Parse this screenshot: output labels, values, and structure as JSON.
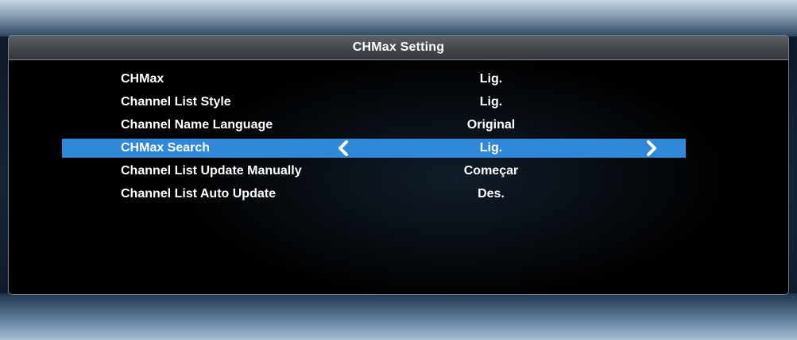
{
  "window": {
    "title": "CHMax Setting"
  },
  "menu": {
    "items": [
      {
        "label": "CHMax",
        "value": "Lig."
      },
      {
        "label": "Channel List Style",
        "value": "Lig."
      },
      {
        "label": "Channel Name Language",
        "value": "Original"
      },
      {
        "label": "CHMax Search",
        "value": "Lig.",
        "selected": true
      },
      {
        "label": "Channel List Update Manually",
        "value": "Começar"
      },
      {
        "label": "Channel List Auto Update",
        "value": "Des."
      }
    ]
  },
  "icons": {
    "prev": "chevron-left-icon",
    "next": "chevron-right-icon"
  },
  "colors": {
    "highlight": "#2f88d8",
    "text": "#ffffff",
    "panel_background": "#000000",
    "title_bar": "#45494d"
  }
}
